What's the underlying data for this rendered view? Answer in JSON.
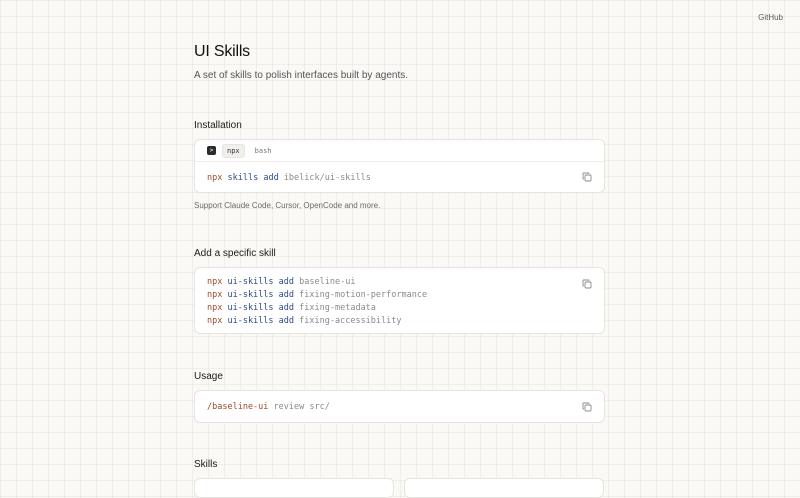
{
  "nav": {
    "github_label": "GitHub"
  },
  "header": {
    "title": "UI Skills",
    "subtitle": "A set of skills to polish interfaces built by agents."
  },
  "installation": {
    "heading": "Installation",
    "tabs": [
      {
        "label": "npx",
        "active": true
      },
      {
        "label": "bash",
        "active": false
      }
    ],
    "command": {
      "cmd": "npx",
      "pkg": "skills",
      "sub": "add",
      "arg": "ibelick/ui-skills"
    },
    "support_text": "Support Claude Code, Cursor, OpenCode and more."
  },
  "add_skill": {
    "heading": "Add a specific skill",
    "commands": [
      {
        "cmd": "npx",
        "pkg": "ui-skills",
        "sub": "add",
        "arg": "baseline-ui"
      },
      {
        "cmd": "npx",
        "pkg": "ui-skills",
        "sub": "add",
        "arg": "fixing-motion-performance"
      },
      {
        "cmd": "npx",
        "pkg": "ui-skills",
        "sub": "add",
        "arg": "fixing-metadata"
      },
      {
        "cmd": "npx",
        "pkg": "ui-skills",
        "sub": "add",
        "arg": "fixing-accessibility"
      }
    ]
  },
  "usage": {
    "heading": "Usage",
    "command": {
      "slash": "/baseline-ui",
      "arg": "review src/"
    }
  },
  "skills": {
    "heading": "Skills"
  },
  "icons": {
    "copy": "copy-icon",
    "terminal": "terminal-icon"
  },
  "colors": {
    "background": "#faf9f6",
    "card": "#ffffff",
    "command": "#9a4a2e",
    "package": "#2c4a8a",
    "argument": "#8a8a8a"
  }
}
